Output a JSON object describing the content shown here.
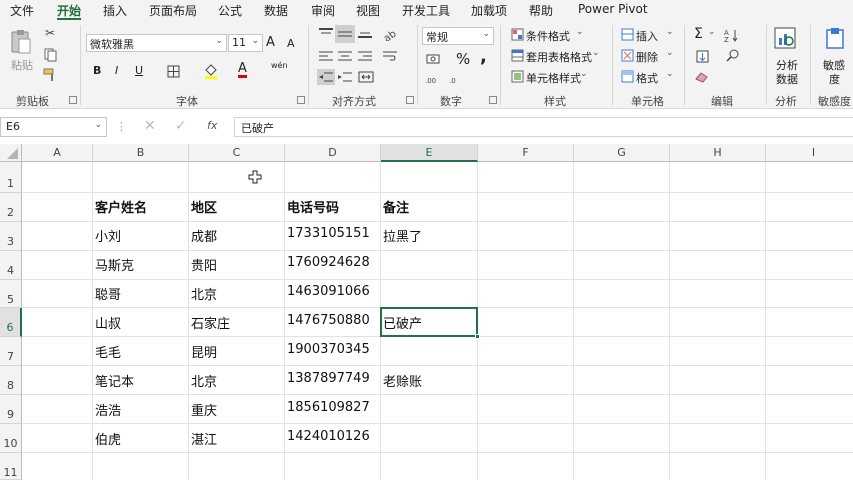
{
  "tabs": [
    "文件",
    "开始",
    "插入",
    "页面布局",
    "公式",
    "数据",
    "审阅",
    "视图",
    "开发工具",
    "加载项",
    "帮助",
    "Power Pivot"
  ],
  "ribbon": {
    "clipboard": {
      "paste": "粘贴",
      "label": "剪贴板"
    },
    "font": {
      "name": "微软雅黑",
      "size": "11",
      "label": "字体",
      "grow": "A",
      "shrink": "A",
      "bold": "B",
      "italic": "I",
      "underline": "U",
      "fontcolor": "A",
      "wen": "wén"
    },
    "alignment": {
      "label": "对齐方式"
    },
    "number": {
      "format": "常规",
      "label": "数字",
      "percent": "%",
      "comma": ","
    },
    "styles": {
      "conditional": "条件格式",
      "table": "套用表格格式",
      "cell": "单元格样式",
      "label": "样式"
    },
    "cells": {
      "insert": "插入",
      "delete": "删除",
      "format": "格式",
      "label": "单元格"
    },
    "editing": {
      "label": "编辑",
      "sigma": "Σ"
    },
    "analysis": {
      "button": "分析数据",
      "button_l1": "分析",
      "button_l2": "数据",
      "label": "分析"
    },
    "sensitivity": {
      "button_l1": "敏感",
      "button_l2": "度",
      "label": "敏感度"
    }
  },
  "formula_bar": {
    "name_box": "E6",
    "fx": "fx",
    "value": "已破产"
  },
  "sheet": {
    "columns": [
      "A",
      "B",
      "C",
      "D",
      "E",
      "F",
      "G",
      "H",
      "I"
    ],
    "rows": [
      "1",
      "2",
      "3",
      "4",
      "5",
      "6",
      "7",
      "8",
      "9",
      "10",
      "11"
    ],
    "header": {
      "name": "客户姓名",
      "region": "地区",
      "phone": "电话号码",
      "note": "备注"
    },
    "records": [
      {
        "name": "小刘",
        "region": "成都",
        "phone": "1733105151",
        "note": "拉黑了"
      },
      {
        "name": "马斯克",
        "region": "贵阳",
        "phone": "1760924628",
        "note": ""
      },
      {
        "name": "聪哥",
        "region": "北京",
        "phone": "1463091066",
        "note": ""
      },
      {
        "name": "山叔",
        "region": "石家庄",
        "phone": "1476750880",
        "note": "已破产"
      },
      {
        "name": "毛毛",
        "region": "昆明",
        "phone": "1900370345",
        "note": ""
      },
      {
        "name": "笔记本",
        "region": "北京",
        "phone": "1387897749",
        "note": "老赊账"
      },
      {
        "name": "浩浩",
        "region": "重庆",
        "phone": "1856109827",
        "note": ""
      },
      {
        "name": "伯虎",
        "region": "湛江",
        "phone": "1424010126",
        "note": ""
      }
    ]
  },
  "colors": {
    "accent": "#217346",
    "ribbon_bg": "#f3f3f3",
    "grid": "#e1e1e1"
  }
}
